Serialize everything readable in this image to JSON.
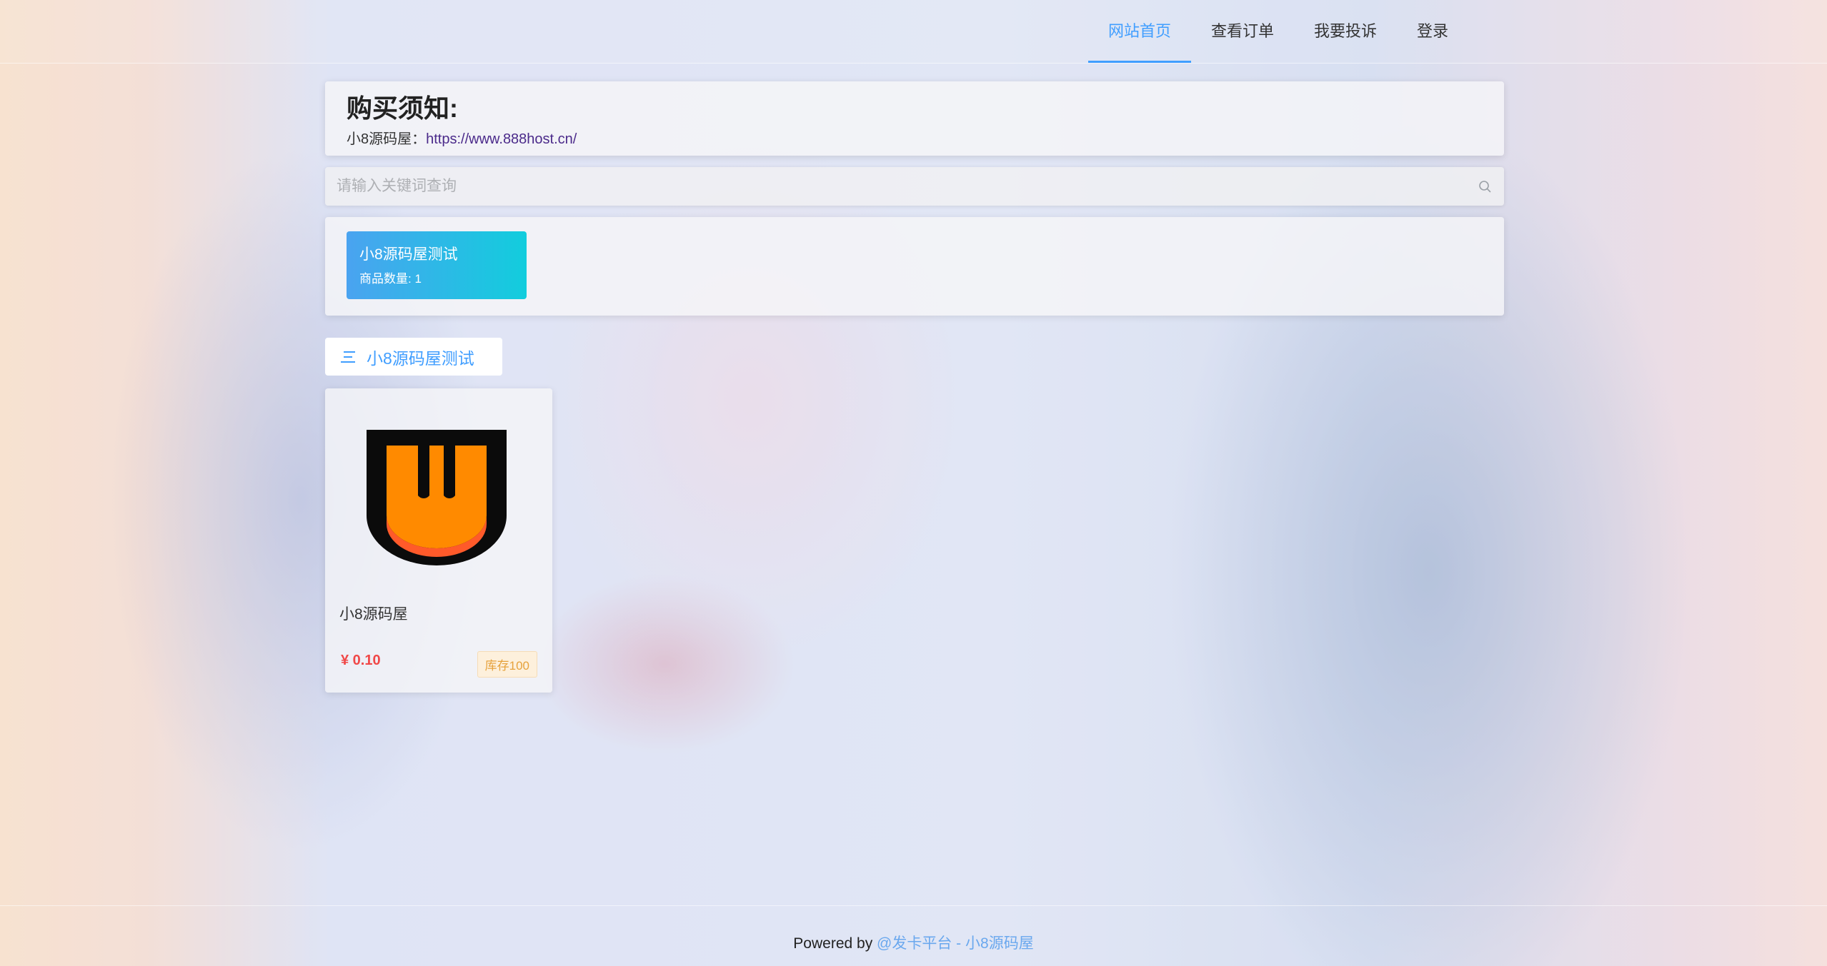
{
  "nav": {
    "items": [
      {
        "label": "网站首页",
        "active": true
      },
      {
        "label": "查看订单",
        "active": false
      },
      {
        "label": "我要投诉",
        "active": false
      },
      {
        "label": "登录",
        "active": false
      }
    ]
  },
  "notice": {
    "title": "购买须知:",
    "line_prefix": "小8源码屋：",
    "link_text": "https://www.888host.cn/"
  },
  "search": {
    "placeholder": "请输入关键词查询",
    "icon": "search-icon"
  },
  "categories": [
    {
      "name": "小8源码屋测试",
      "count_label": "商品数量: 1"
    }
  ],
  "section": {
    "title": "小8源码屋测试",
    "icon": "menu-icon"
  },
  "products": [
    {
      "name": "小8源码屋",
      "price": "¥ 0.10",
      "stock": "库存100",
      "image_icon": "w-logo-icon"
    }
  ],
  "footer": {
    "prefix": "Powered by ",
    "link": "@发卡平台 - 小8源码屋"
  },
  "colors": {
    "accent": "#409eff",
    "price": "#f04848",
    "stock": "#e6a23c",
    "category_gradient_start": "#4aa3f0",
    "category_gradient_end": "#12cddd",
    "logo_orange": "#ff8a00"
  }
}
